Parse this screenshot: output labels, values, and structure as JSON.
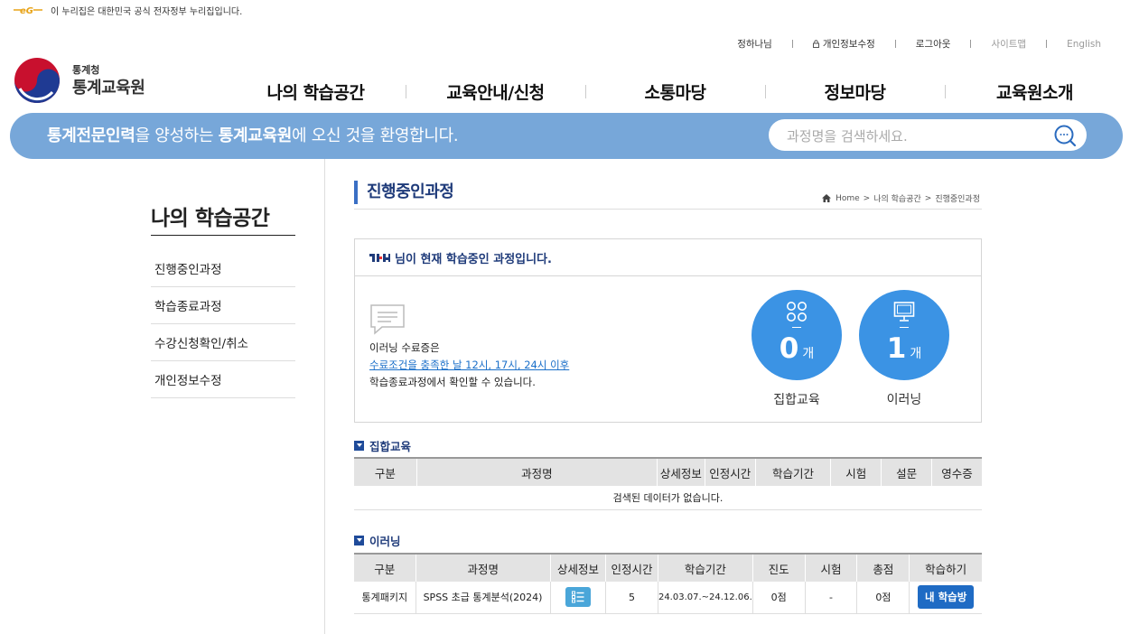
{
  "gov_banner": {
    "text": "이 누리집은 대한민국 공식 전자정부 누리집입니다."
  },
  "util_nav": {
    "user": "정하나님",
    "profile_edit": "개인정보수정",
    "logout": "로그아웃",
    "sitemap": "사이트맵",
    "english": "English"
  },
  "logo": {
    "sub": "통계청",
    "main": "통계교육원"
  },
  "gnb": [
    "나의 학습공간",
    "교육안내/신청",
    "소통마당",
    "정보마당",
    "교육원소개"
  ],
  "welcome": {
    "part1": "통계전문인력",
    "part2": "을 양성하는 ",
    "part3": "통계교육원",
    "part4": "에 오신 것을 환영합니다."
  },
  "search": {
    "placeholder": "과정명을 검색하세요."
  },
  "lnb": {
    "title": "나의 학습공간",
    "items": [
      "진행중인과정",
      "학습종료과정",
      "수강신청확인/취소",
      "개인정보수정"
    ]
  },
  "page": {
    "title": "진행중인과정",
    "breadcrumb": [
      "Home",
      ">",
      "나의 학습공간",
      ">",
      "진행중인과정"
    ]
  },
  "summary": {
    "message": "님이 현재 학습중인 과정입니다.",
    "note1": "이러닝 수료증은",
    "note2": "수료조건을 충족한 날 12시, 17시, 24시 이후",
    "note3": "학습종료과정에서 확인할 수 있습니다.",
    "stats": [
      {
        "count": "0",
        "unit": "개",
        "label": "집합교육",
        "icon": "group-icon"
      },
      {
        "count": "1",
        "unit": "개",
        "label": "이러닝",
        "icon": "monitor-icon"
      }
    ],
    "accent": "#3b93e4"
  },
  "offline": {
    "title": "집합교육",
    "headers": [
      "구분",
      "과정명",
      "상세정보",
      "인정시간",
      "학습기간",
      "시험",
      "설문",
      "영수증"
    ],
    "empty": "검색된 데이터가 없습니다."
  },
  "elearning": {
    "title": "이러닝",
    "headers": [
      "구분",
      "과정명",
      "상세정보",
      "인정시간",
      "학습기간",
      "진도",
      "시험",
      "총점",
      "학습하기"
    ],
    "rows": [
      {
        "category": "통계패키지",
        "course": "SPSS 초급 통계분석(2024)",
        "hours": "5",
        "period": "24.03.07.~24.12.06.",
        "progress": "0점",
        "exam": "-",
        "total": "0점",
        "action": "내 학습방"
      }
    ]
  }
}
